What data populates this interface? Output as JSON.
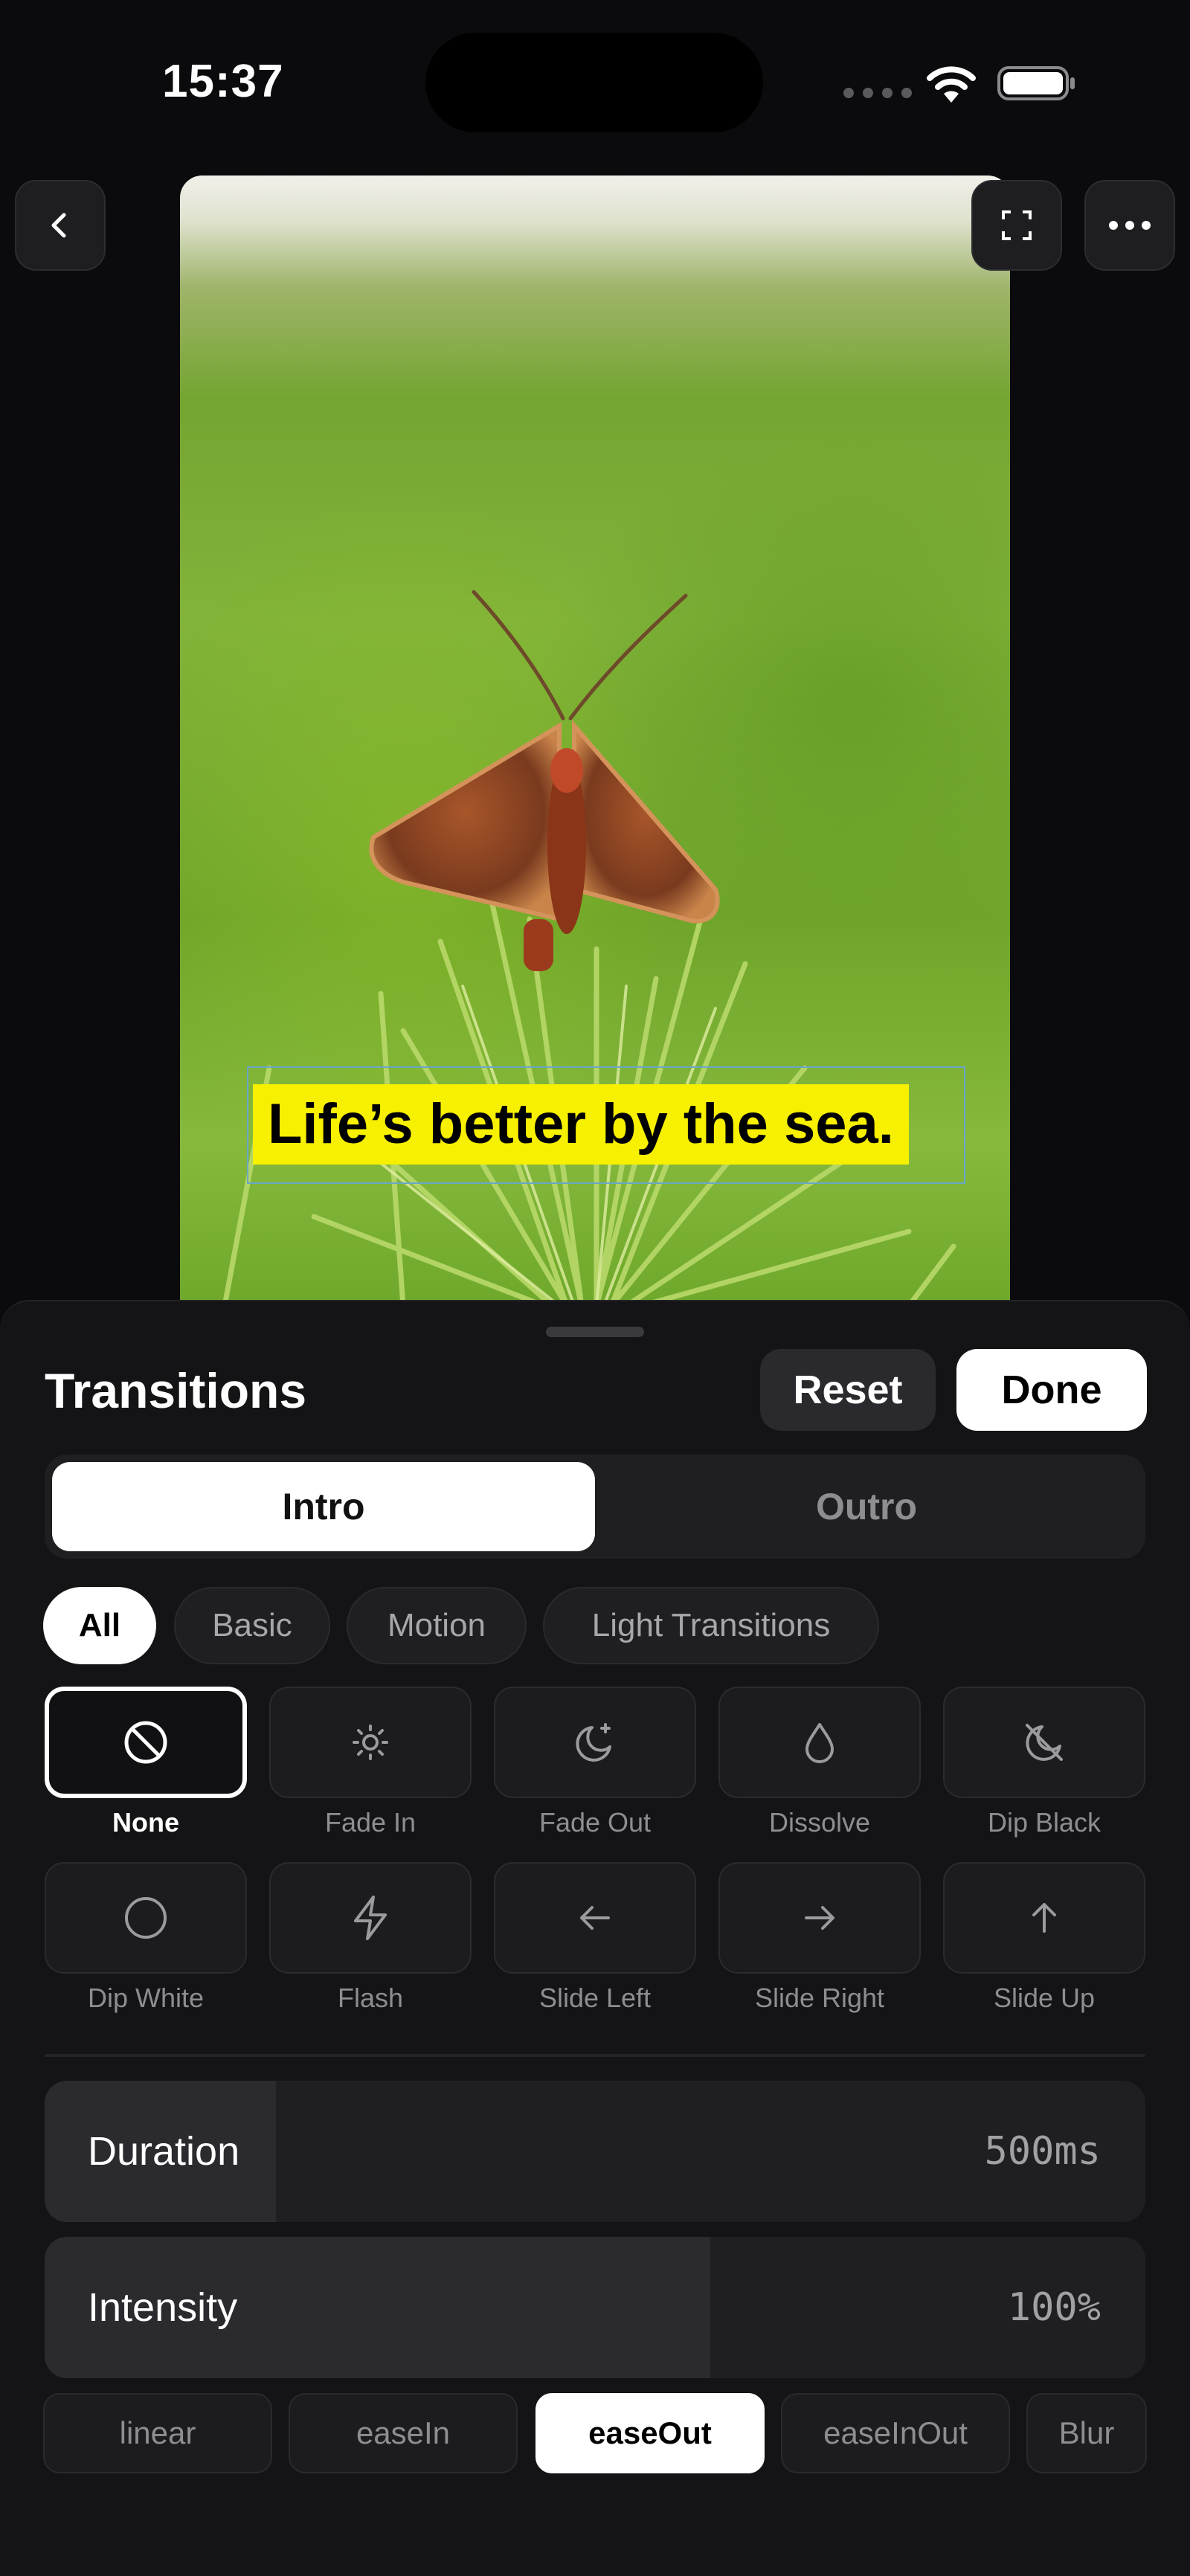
{
  "status_bar": {
    "time": "15:37"
  },
  "preview": {
    "caption": "Life’s better by the sea."
  },
  "sheet": {
    "title": "Transitions",
    "reset_label": "Reset",
    "done_label": "Done",
    "tabs": [
      {
        "label": "Intro",
        "selected": true
      },
      {
        "label": "Outro",
        "selected": false
      }
    ],
    "categories": [
      {
        "label": "All",
        "selected": true
      },
      {
        "label": "Basic",
        "selected": false
      },
      {
        "label": "Motion",
        "selected": false
      },
      {
        "label": "Light Transitions",
        "selected": false
      }
    ],
    "transitions": [
      {
        "label": "None",
        "icon": "prohibit-icon",
        "selected": true
      },
      {
        "label": "Fade In",
        "icon": "sun-icon",
        "selected": false
      },
      {
        "label": "Fade Out",
        "icon": "moon-icon",
        "selected": false
      },
      {
        "label": "Dissolve",
        "icon": "drop-icon",
        "selected": false
      },
      {
        "label": "Dip Black",
        "icon": "moon-off-icon",
        "selected": false
      },
      {
        "label": "Dip White",
        "icon": "circle-icon",
        "selected": false
      },
      {
        "label": "Flash",
        "icon": "bolt-icon",
        "selected": false
      },
      {
        "label": "Slide Left",
        "icon": "arrow-left-icon",
        "selected": false
      },
      {
        "label": "Slide Right",
        "icon": "arrow-right-icon",
        "selected": false
      },
      {
        "label": "Slide Up",
        "icon": "arrow-up-icon",
        "selected": false
      }
    ],
    "duration": {
      "label": "Duration",
      "value": "500ms",
      "level": 0.21
    },
    "intensity": {
      "label": "Intensity",
      "value": "100%",
      "level": 0.605
    },
    "easing": [
      {
        "label": "linear",
        "selected": false
      },
      {
        "label": "easeIn",
        "selected": false
      },
      {
        "label": "easeOut",
        "selected": true
      },
      {
        "label": "easeInOut",
        "selected": false
      },
      {
        "label": "Blur",
        "selected": false
      }
    ]
  },
  "colors": {
    "caption_background": "#f7f000",
    "accent": "#ffffff",
    "sheet_background": "#141416"
  }
}
